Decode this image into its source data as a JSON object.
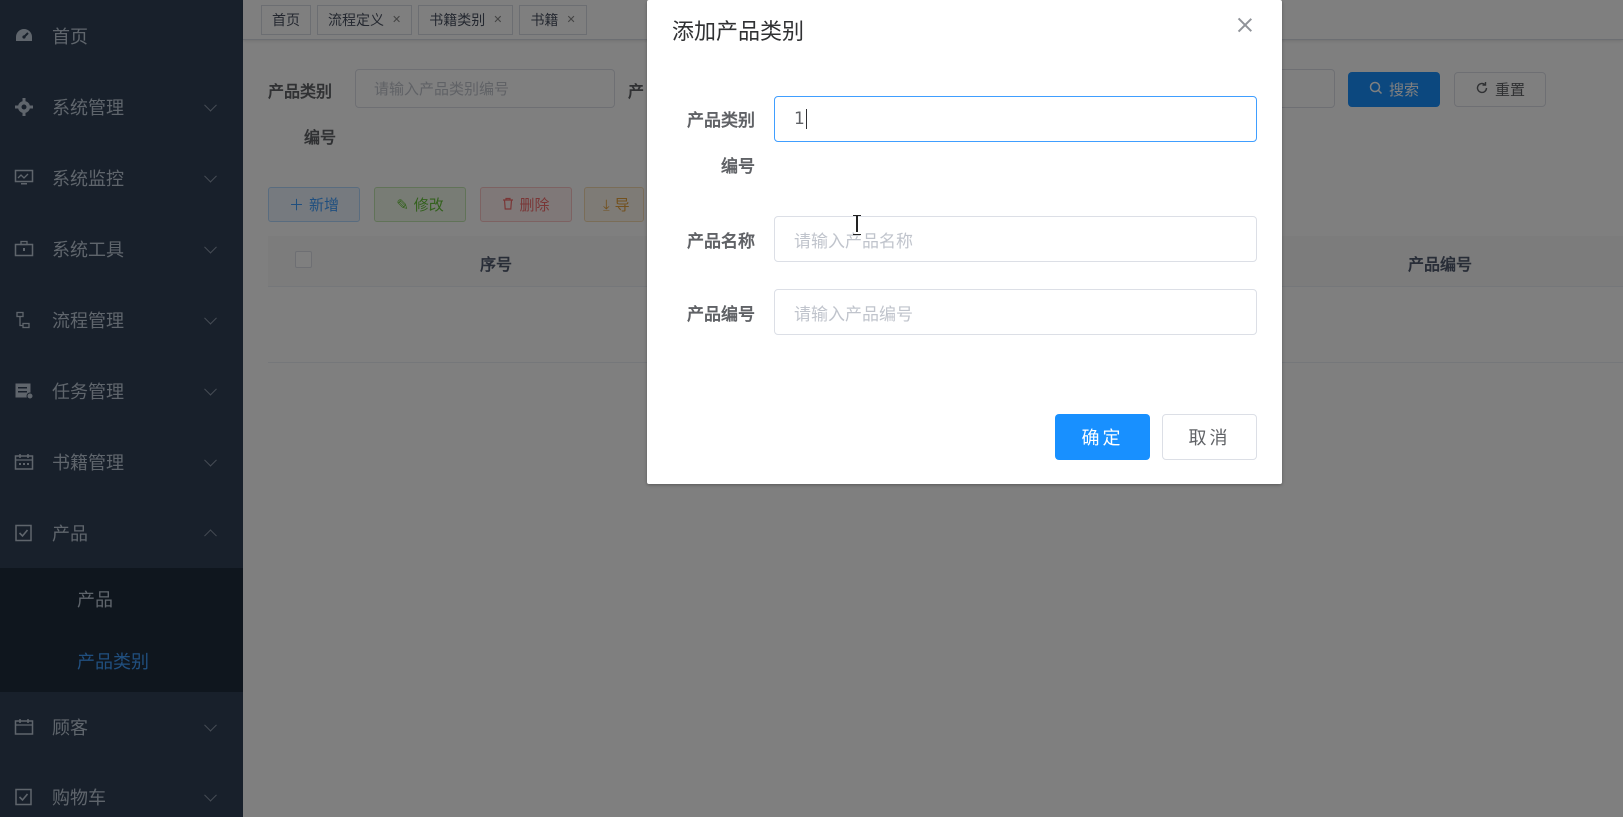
{
  "sidebar": {
    "items": [
      {
        "label": "首页",
        "icon": "dashboard-icon",
        "arrow": "none"
      },
      {
        "label": "系统管理",
        "icon": "gear-icon",
        "arrow": "down"
      },
      {
        "label": "系统监控",
        "icon": "monitor-icon",
        "arrow": "down"
      },
      {
        "label": "系统工具",
        "icon": "toolbox-icon",
        "arrow": "down"
      },
      {
        "label": "流程管理",
        "icon": "flow-icon",
        "arrow": "down"
      },
      {
        "label": "任务管理",
        "icon": "task-icon",
        "arrow": "down"
      },
      {
        "label": "书籍管理",
        "icon": "calendar-icon",
        "arrow": "down"
      },
      {
        "label": "产品",
        "icon": "checkbox-icon",
        "arrow": "up"
      }
    ],
    "submenu": [
      {
        "label": "产品",
        "active": false
      },
      {
        "label": "产品类别",
        "active": true
      }
    ],
    "items_after": [
      {
        "label": "顾客",
        "icon": "calendar-icon",
        "arrow": "down"
      },
      {
        "label": "购物车",
        "icon": "checkbox-icon",
        "arrow": "down"
      }
    ]
  },
  "tags": [
    {
      "label": "首页",
      "closable": false
    },
    {
      "label": "流程定义",
      "closable": true
    },
    {
      "label": "书籍类别",
      "closable": true
    },
    {
      "label": "书籍",
      "closable": true
    }
  ],
  "search": {
    "label_line1": "产品类别",
    "label_line2": "编号",
    "input_placeholder": "请输入产品类别编号",
    "label2_partial": "产",
    "search_button": "搜索",
    "reset_button": "重置"
  },
  "toolbar": {
    "add": "新增",
    "edit": "修改",
    "delete": "删除",
    "export_partial": "导"
  },
  "table": {
    "headers": [
      "序号",
      "产品编号"
    ]
  },
  "dialog": {
    "title": "添加产品类别",
    "fields": [
      {
        "label_line1": "产品类别",
        "label_line2": "编号",
        "value": "1",
        "placeholder": ""
      },
      {
        "label": "产品名称",
        "value": "",
        "placeholder": "请输入产品名称"
      },
      {
        "label": "产品编号",
        "value": "",
        "placeholder": "请输入产品编号"
      }
    ],
    "confirm_button": "确定",
    "cancel_button": "取消"
  },
  "colors": {
    "sidebar_bg": "#304156",
    "submenu_bg": "#1f2d3d",
    "primary": "#409eff",
    "active_text": "#409eff"
  }
}
